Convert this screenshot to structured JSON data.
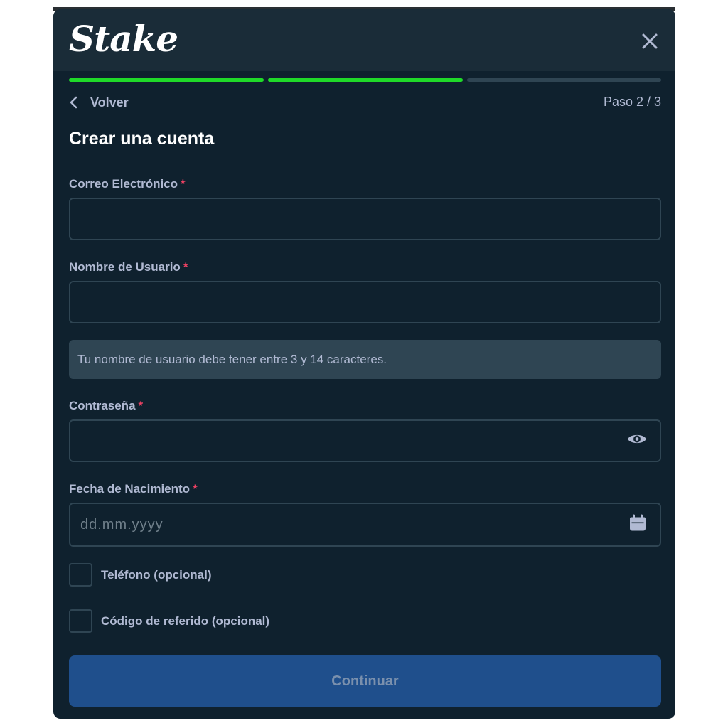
{
  "header": {
    "logo_text": "Stake",
    "close_icon": "close-icon"
  },
  "progress": {
    "total_steps": 3,
    "completed_steps": 2,
    "active_color": "#1fda29",
    "inactive_color": "#2f4553"
  },
  "nav": {
    "back_label": "Volver",
    "back_icon": "chevron-left-icon",
    "step_text": "Paso 2 / 3"
  },
  "form": {
    "title": "Crear una cuenta",
    "required_marker": "*",
    "email": {
      "label": "Correo Electrónico",
      "value": "",
      "placeholder": ""
    },
    "username": {
      "label": "Nombre de Usuario",
      "value": "",
      "placeholder": ""
    },
    "username_hint": "Tu nombre de usuario debe tener entre 3 y 14 caracteres.",
    "password": {
      "label": "Contraseña",
      "value": "",
      "placeholder": "",
      "icon": "eye-icon"
    },
    "birthdate": {
      "label": "Fecha de Nacimiento",
      "value": "",
      "placeholder": "dd.mm.yyyy",
      "icon": "calendar-icon"
    },
    "phone_option": {
      "label": "Teléfono (opcional)",
      "checked": false
    },
    "referral_option": {
      "label": "Código de referido (opcional)",
      "checked": false
    },
    "submit_label": "Continuar"
  },
  "colors": {
    "background": "#0f212e",
    "header": "#1a2c38",
    "field_border": "#2f4553",
    "text_muted": "#b1bad3",
    "required": "#ed4163",
    "primary_button": "#1f4f8c"
  }
}
